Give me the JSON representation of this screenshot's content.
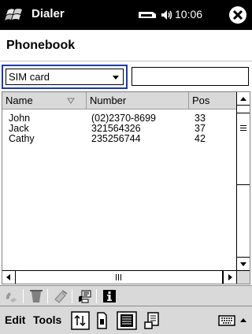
{
  "titlebar": {
    "app_title": "Dialer",
    "time": "10:06"
  },
  "header": {
    "title": "Phonebook"
  },
  "filter": {
    "selected": "SIM card",
    "search_value": ""
  },
  "list": {
    "columns": [
      "Name",
      "Number",
      "Pos"
    ],
    "rows": [
      {
        "name": "John",
        "number": "(02)2370-8699",
        "pos": "33"
      },
      {
        "name": "Jack",
        "number": "321564326",
        "pos": "37"
      },
      {
        "name": "Cathy",
        "number": "235256744",
        "pos": "42"
      }
    ]
  },
  "menu": {
    "edit": "Edit",
    "tools": "Tools"
  },
  "icons": {
    "titlebar": [
      "windows-start-icon",
      "battery-icon",
      "speaker-icon",
      "close-icon"
    ],
    "toolbar": [
      "dial-icon",
      "delete-icon",
      "copy-icon",
      "sms-icon",
      "info-icon"
    ],
    "menubar": [
      "sort-icon",
      "sim-icon",
      "phonebook-icon",
      "contacts-icon",
      "keyboard-icon"
    ]
  },
  "colors": {
    "titlebar": "#000000",
    "focus_border": "#1f3aa6",
    "close_button": "#ffffff",
    "bars": "#d9d9d9"
  }
}
